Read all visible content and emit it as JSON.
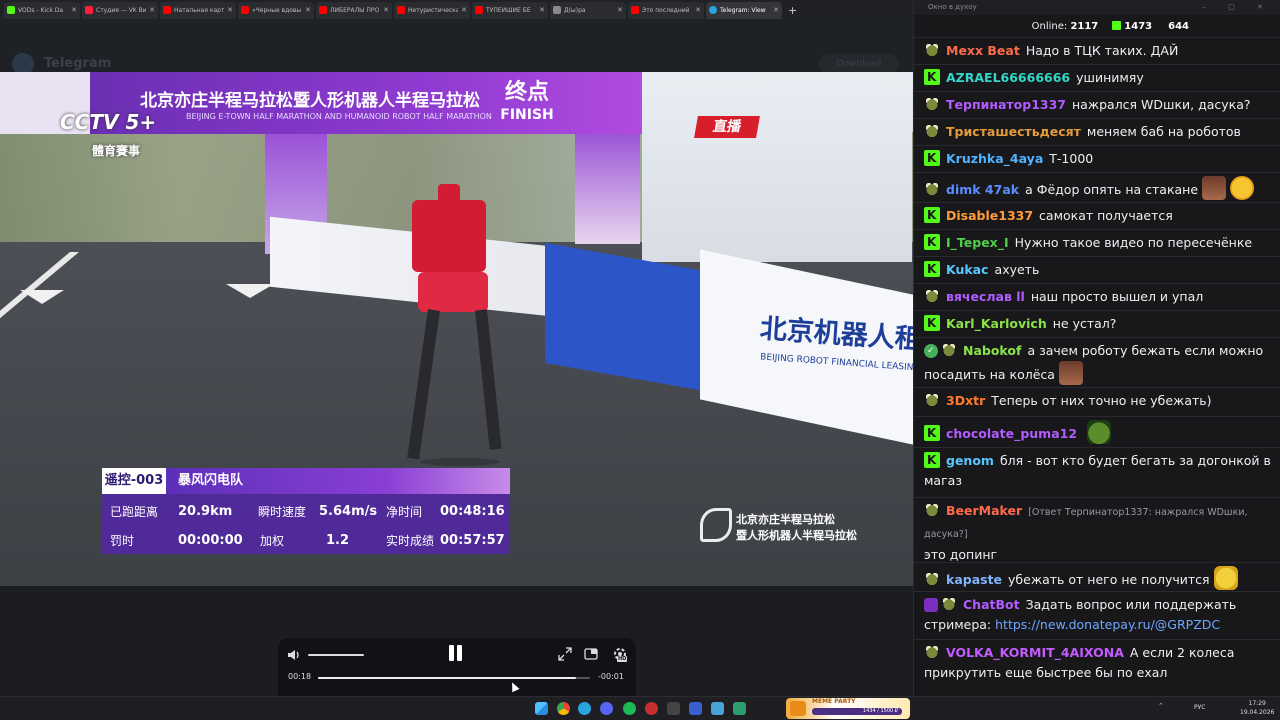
{
  "browser": {
    "tabs": [
      {
        "label": "VODs - Kick Da",
        "favicon": "kick-icon",
        "active": false
      },
      {
        "label": "Студия — VK Ви",
        "favicon": "vk-icon",
        "active": false
      },
      {
        "label": "Натальная карт",
        "favicon": "youtube-icon",
        "active": false
      },
      {
        "label": "«Черные вдовы",
        "favicon": "youtube-icon",
        "active": false
      },
      {
        "label": "ЛИБЕРАЛЫ ПРО",
        "favicon": "youtube-icon",
        "active": false
      },
      {
        "label": "Нетуристическа",
        "favicon": "youtube-icon",
        "active": false
      },
      {
        "label": "ТУПЕЙШИЕ БЕ",
        "favicon": "youtube-icon",
        "active": false
      },
      {
        "label": "Д(ы)ра",
        "favicon": "generic-icon",
        "active": false
      },
      {
        "label": "Это последний",
        "favicon": "youtube-icon",
        "active": false
      },
      {
        "label": "Telegram: View",
        "favicon": "telegram-icon",
        "active": true
      }
    ],
    "new_tab": "+"
  },
  "telegram": {
    "title": "Telegram",
    "button": "Download"
  },
  "video": {
    "channel": "CCTV 5+",
    "channel_sub": "體育賽事",
    "live_badge": "直播",
    "arch_title": "北京亦庄半程马拉松暨人形机器人半程马拉松",
    "arch_subtitle": "BEIJING E-TOWN HALF MARATHON AND HUMANOID ROBOT HALF MARATHON",
    "finish_zh": "终点",
    "finish_en": "FINISH",
    "sponsor_zh": "北京机器人租",
    "sponsor_en": "BEIJING ROBOT FINANCIAL LEASING",
    "watermark_line1": "北京亦庄半程马拉松",
    "watermark_line2": "暨人形机器人半程马拉松",
    "scoreboard": {
      "team_id": "遥控-003",
      "team_name": "暴风闪电队",
      "distance_label": "已跑距离",
      "distance": "20.9km",
      "speed_label": "瞬时速度",
      "speed": "5.64m/s",
      "net_time_label": "净时间",
      "net_time": "00:48:16",
      "penalty_label": "罚时",
      "penalty": "00:00:00",
      "weight_label": "加权",
      "weight": "1.2",
      "actual_label": "实时成绩",
      "actual": "00:57:57"
    }
  },
  "player": {
    "time_current": "00:18",
    "time_remaining": "-00:01",
    "progress": 0.95,
    "volume": 1.0,
    "hd": "HD"
  },
  "chat": {
    "window_title": "Окно в духоу",
    "online_label": "Online:",
    "online_count": "2117",
    "kick_count": "1473",
    "frog_count": "644",
    "colors": {
      "accent": "#53fc18",
      "link": "#6fa7ff",
      "bg": "#18181b"
    },
    "messages": [
      {
        "badge": "frog",
        "user": "Mexx Beat",
        "color": "#ff6b4a",
        "text": "Надо в ТЦК таких. ДАЙ"
      },
      {
        "badge": "kick",
        "user": "AZRAEL66666666",
        "color": "#34d6c8",
        "text": "ушинимяу"
      },
      {
        "badge": "frog",
        "user": "Терпинатор1337",
        "color": "#b25cff",
        "text": "нажрался WDшки, дасука?"
      },
      {
        "badge": "frog",
        "user": "Тристашестьдесят",
        "color": "#e39a3b",
        "text": "меняем баб на роботов"
      },
      {
        "badge": "kick",
        "user": "Kruzhka_4aya",
        "color": "#4fb3ff",
        "text": "Т-1000"
      },
      {
        "badge": "frog",
        "user": "dimk 47ak",
        "color": "#5a8dff",
        "text": "а Фёдор опять на стакане",
        "emotes": [
          "face",
          "laugh"
        ]
      },
      {
        "badge": "kick",
        "user": "Disable1337",
        "color": "#ff9b3b",
        "text": "самокат получается"
      },
      {
        "badge": "kick",
        "user": "I_Tepex_I",
        "color": "#51d14a",
        "text": "Нужно такое видео по пересечёнке"
      },
      {
        "badge": "kick",
        "user": "Kukac",
        "color": "#58c7ff",
        "text": "ахуеть"
      },
      {
        "badge": "frog",
        "user": "вячеслав ll",
        "color": "#b25cff",
        "text": "наш просто вышел и упал"
      },
      {
        "badge": "kick",
        "user": "Karl_Karlovich",
        "color": "#8be34a",
        "text": "не устал?"
      },
      {
        "badge": "check",
        "user": "Nabokof",
        "color": "#8be34a",
        "text": "а зачем роботу бежать если можно посадить на колёса",
        "emotes": [
          "face"
        ]
      },
      {
        "badge": "frog",
        "user": "3Dxtr",
        "color": "#ff7a2a",
        "text": "Теперь от них точно не убежать)"
      },
      {
        "badge": "kick",
        "user": "chocolate_puma12",
        "color": "#b25cff",
        "text": "",
        "emotes": [
          "pepe"
        ]
      },
      {
        "badge": "kick",
        "user": "genom",
        "color": "#58c7ff",
        "text": "бля - вот кто будет бегать за догонкой в магаз"
      },
      {
        "badge": "frog",
        "user": "BeerMaker",
        "color": "#ff6b4a",
        "reply": "[Ответ Терпинатор1337: нажрался WDшки, дасука?]",
        "text": "это допинг"
      },
      {
        "badge": "frog",
        "user": "kapaste",
        "color": "#7fb4ff",
        "text": "убежать от него не получится",
        "emotes": [
          "happy"
        ]
      },
      {
        "badge": "bot",
        "user": "ChatBot",
        "color": "#b25cff",
        "text": "Задать вопрос или поддержать стримера:",
        "link": "https://new.donatepay.ru/@GRPZDC"
      },
      {
        "badge": "frog",
        "user": "VOLKA_KORMIT_4AIXONA",
        "color": "#c25cff",
        "text": "А если 2 колеса прикрутить еще быстрее бы по ехал"
      }
    ]
  },
  "taskbar": {
    "banner_title": "MEME PARTY",
    "banner_sub": "1434 / 1500 ₽",
    "lang": "РУС",
    "time": "17:29",
    "date": "19.04.2026"
  }
}
